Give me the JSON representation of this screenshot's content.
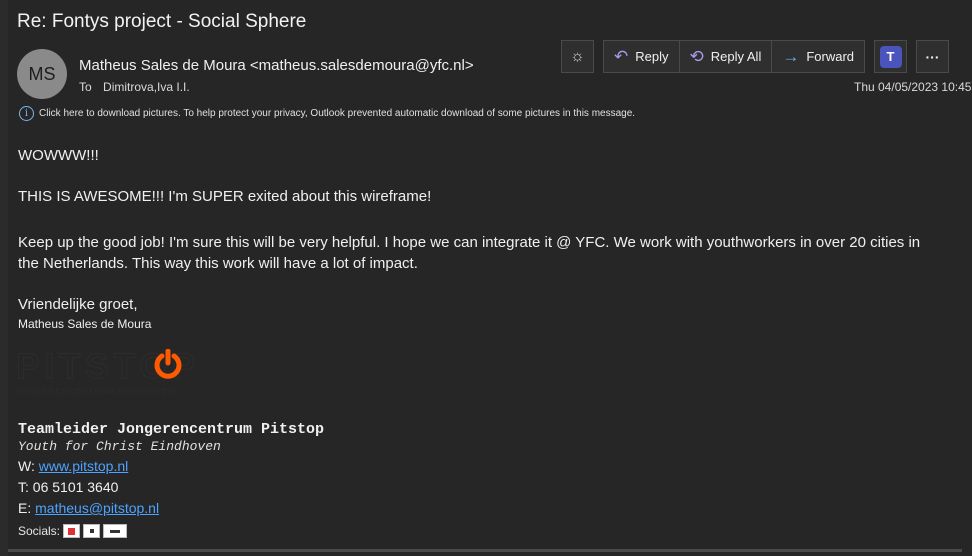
{
  "email": {
    "subject": "Re: Fontys project - Social Sphere",
    "avatar_initials": "MS",
    "sender": "Matheus Sales de Moura <matheus.salesdemoura@yfc.nl>",
    "to_label": "To",
    "recipient": "Dimitrova,Iva I.I.",
    "date": "Thu 04/05/2023 10:45",
    "info_message": "Click here to download pictures. To help protect your privacy, Outlook prevented automatic download of some pictures in this message."
  },
  "toolbar": {
    "reply_label": "Reply",
    "reply_all_label": "Reply All",
    "forward_label": "Forward",
    "more_label": "···"
  },
  "body": {
    "line1": "WOWWW!!!",
    "line2": "THIS IS AWESOME!!! I'm SUPER exited about this wireframe!",
    "para3_line1": "Keep up the good job! I'm sure this will be very helpful. I hope we can integrate it @ YFC. We work with youthworkers in over 20 cities in",
    "para3_line2": "the Netherlands. This way this work will have a lot of impact.",
    "closing": "Vriendelijke groet,",
    "signature_name": "Matheus Sales de Moura"
  },
  "signature": {
    "logo_text": "PITSTOP",
    "logo_subtext": "JONGERENCENTRUM EINDHOVEN",
    "title": "Teamleider Jongerencentrum Pitstop",
    "org": "Youth for Christ Eindhoven",
    "web_label": "W: ",
    "web": "www.pitstop.nl",
    "phone": "T: 06 5101 3640",
    "email_label": "E: ",
    "email": "matheus@pitstop.nl",
    "socials_label": "Socials:"
  },
  "colors": {
    "background": "#262626",
    "link": "#4da3ff",
    "accent_purple": "#a79bea",
    "logo_orange": "#ff5a00"
  }
}
